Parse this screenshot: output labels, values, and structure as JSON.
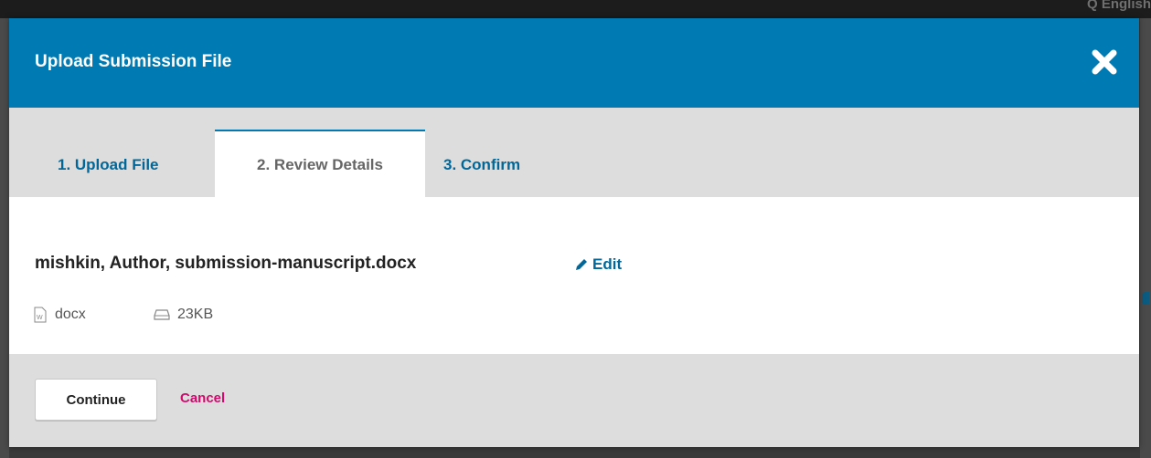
{
  "backdrop": {
    "language_label": "Q  English"
  },
  "modal": {
    "title": "Upload Submission File",
    "close_icon": "close-x-icon"
  },
  "tabs": [
    {
      "label": "1. Upload File",
      "active": false
    },
    {
      "label": "2. Review Details",
      "active": true
    },
    {
      "label": "3. Confirm",
      "active": false
    }
  ],
  "file": {
    "name": "mishkin, Author, submission-manuscript.docx",
    "edit_label": "Edit",
    "edit_icon": "pencil-icon",
    "type": "docx",
    "type_icon": "word-file-icon",
    "size": "23KB",
    "size_icon": "hard-drive-icon"
  },
  "footer": {
    "continue_label": "Continue",
    "cancel_label": "Cancel"
  },
  "colors": {
    "header": "#007ab2",
    "link": "#006798",
    "cancel": "#d00a6c"
  }
}
